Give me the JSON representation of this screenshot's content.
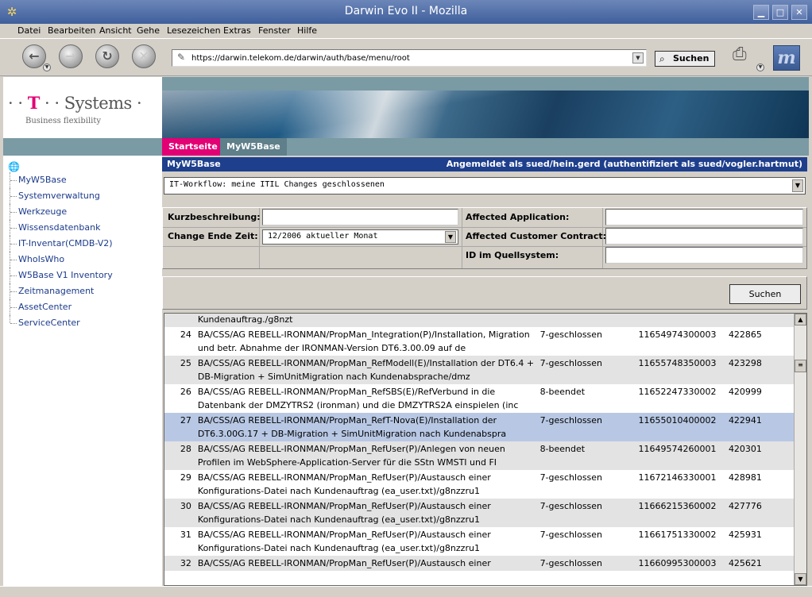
{
  "window": {
    "title": "Darwin Evo II - Mozilla"
  },
  "menu": [
    "Datei",
    "Bearbeiten",
    "Ansicht",
    "Gehe",
    "Lesezeichen",
    "Extras",
    "Fenster",
    "Hilfe"
  ],
  "toolbar": {
    "url": "https://darwin.telekom.de/darwin/auth/base/menu/root",
    "search_label": "Suchen"
  },
  "logo": {
    "brand_t": "T",
    "brand_rest": "Systems",
    "tagline": "Business flexibility"
  },
  "nav": {
    "items": [
      "MyW5Base",
      "Systemverwaltung",
      "Werkzeuge",
      "Wissensdatenbank",
      "IT-Inventar(CMDB-V2)",
      "WhoIsWho",
      "W5Base V1 Inventory",
      "Zeitmanagement",
      "AssetCenter",
      "ServiceCenter"
    ]
  },
  "tabs": {
    "home": "Startseite",
    "current": "MyW5Base"
  },
  "header": {
    "left": "MyW5Base",
    "right": "Angemeldet als sued/hein.gerd (authentifiziert als sued/vogler.hartmut)"
  },
  "workflow_select": {
    "value": "IT-Workflow: meine ITIL Changes geschlossenen"
  },
  "filter": {
    "kurz_label": "Kurzbeschreibung:",
    "kurz_value": "",
    "ende_label": "Change Ende Zeit:",
    "ende_value": "12/2006 aktueller Monat",
    "app_label": "Affected Application:",
    "app_value": "",
    "contract_label": "Affected Customer Contract:",
    "contract_value": "",
    "qid_label": "ID im Quellsystem:",
    "qid_value": ""
  },
  "action": {
    "search_label": "Suchen"
  },
  "results": {
    "partial_top": "Kundenauftrag./g8nzt",
    "rows": [
      {
        "no": "24",
        "desc": "BA/CSS/AG REBELL-IRONMAN/PropMan_Integration(P)/Installation, Migration und betr. Abnahme der IRONMAN-Version DT6.3.00.09 auf de",
        "status": "7-geschlossen",
        "id": "11654974300003",
        "num": "422865"
      },
      {
        "no": "25",
        "desc": "BA/CSS/AG REBELL-IRONMAN/PropMan_RefModell(E)/Installation der DT6.4 + DB-Migration + SimUnitMigration nach Kundenabsprache/dmz",
        "status": "7-geschlossen",
        "id": "11655748350003",
        "num": "423298"
      },
      {
        "no": "26",
        "desc": "BA/CSS/AG REBELL-IRONMAN/PropMan_RefSBS(E)/RefVerbund in die Datenbank der DMZYTRS2 (ironman) und die DMZYTRS2A einspielen (inc",
        "status": "8-beendet",
        "id": "11652247330002",
        "num": "420999"
      },
      {
        "no": "27",
        "desc": "BA/CSS/AG REBELL-IRONMAN/PropMan_RefT-Nova(E)/Installation der DT6.3.00G.17 + DB-Migration + SimUnitMigration nach Kundenabspra",
        "status": "7-geschlossen",
        "id": "11655010400002",
        "num": "422941"
      },
      {
        "no": "28",
        "desc": "BA/CSS/AG REBELL-IRONMAN/PropMan_RefUser(P)/Anlegen von neuen Profilen im WebSphere-Application-Server für die SStn WMSTI und FI",
        "status": "8-beendet",
        "id": "11649574260001",
        "num": "420301"
      },
      {
        "no": "29",
        "desc": "BA/CSS/AG REBELL-IRONMAN/PropMan_RefUser(P)/Austausch einer Konfigurations-Datei nach Kundenauftrag (ea_user.txt)/g8nzzru1",
        "status": "7-geschlossen",
        "id": "11672146330001",
        "num": "428981"
      },
      {
        "no": "30",
        "desc": "BA/CSS/AG REBELL-IRONMAN/PropMan_RefUser(P)/Austausch einer Konfigurations-Datei nach Kundenauftrag (ea_user.txt)/g8nzzru1",
        "status": "7-geschlossen",
        "id": "11666215360002",
        "num": "427776"
      },
      {
        "no": "31",
        "desc": "BA/CSS/AG REBELL-IRONMAN/PropMan_RefUser(P)/Austausch einer Konfigurations-Datei nach Kundenauftrag (ea_user.txt)/g8nzzru1",
        "status": "7-geschlossen",
        "id": "11661751330002",
        "num": "425931"
      },
      {
        "no": "32",
        "desc": "BA/CSS/AG REBELL-IRONMAN/PropMan_RefUser(P)/Austausch einer",
        "status": "7-geschlossen",
        "id": "11660995300003",
        "num": "425621"
      }
    ]
  }
}
